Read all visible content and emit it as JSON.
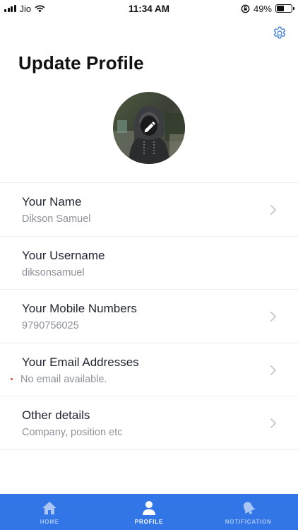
{
  "status_bar": {
    "carrier": "Jio",
    "time": "11:34 AM",
    "battery": "49%",
    "battery_level": 0.49
  },
  "header": {
    "title": "Update Profile",
    "settings_icon": "gear-icon"
  },
  "avatar": {
    "edit_icon": "pencil-icon"
  },
  "fields": [
    {
      "label": "Your Name",
      "value": "Dikson Samuel",
      "has_chevron": true
    },
    {
      "label": "Your Username",
      "value": "diksonsamuel",
      "has_chevron": false
    },
    {
      "label": "Your Mobile Numbers",
      "value": "9790756025",
      "has_chevron": true
    },
    {
      "label": "Your Email Addresses",
      "value": "No email available.",
      "has_chevron": true,
      "warning_dot": true
    },
    {
      "label": "Other details",
      "value": "Company, position etc",
      "has_chevron": true
    }
  ],
  "tabbar": {
    "background": "#3175e6",
    "tabs": [
      {
        "label": "HOME",
        "icon": "home-icon",
        "active": false
      },
      {
        "label": "PROFILE",
        "icon": "user-icon",
        "active": true
      },
      {
        "label": "NOTIFICATION",
        "icon": "bell-icon",
        "active": false
      }
    ]
  },
  "colors": {
    "accent": "#3175e6",
    "chevron": "#c4c6cb",
    "warning_dot": "#e2452b"
  }
}
